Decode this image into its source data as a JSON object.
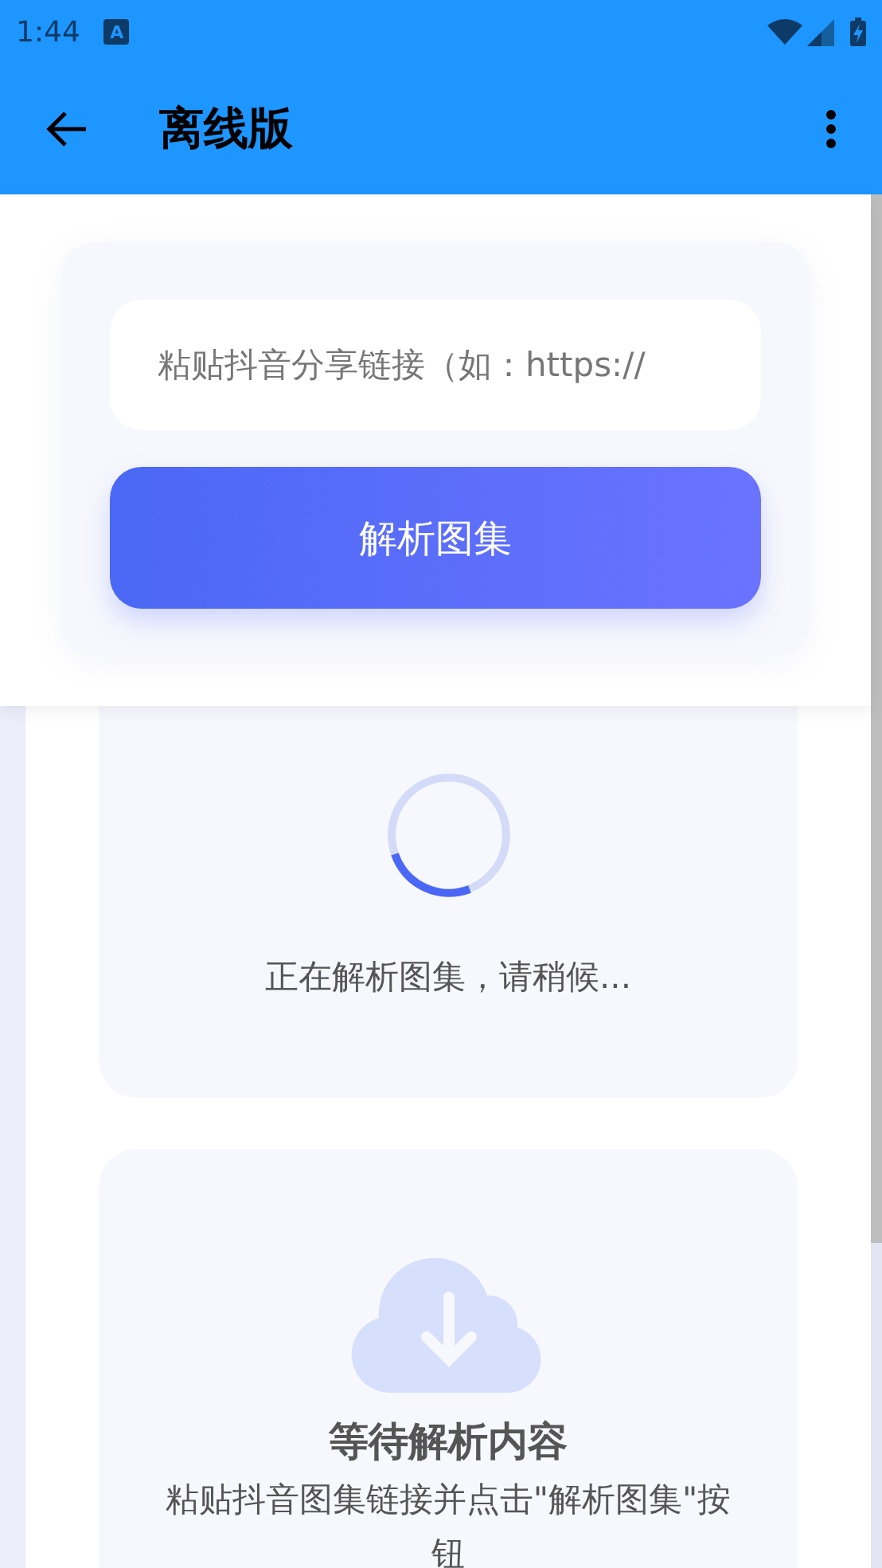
{
  "status_bar": {
    "time": "1:44",
    "notification_letter": "A"
  },
  "app_bar": {
    "title": "离线版"
  },
  "input": {
    "placeholder": "粘贴抖音分享链接（如：https://"
  },
  "parse_button": {
    "label": "解析图集"
  },
  "loading": {
    "message": "正在解析图集，请稍候..."
  },
  "empty_state": {
    "title": "等待解析内容",
    "hint": "粘贴抖音图集链接并点击\"解析图集\"按钮"
  }
}
